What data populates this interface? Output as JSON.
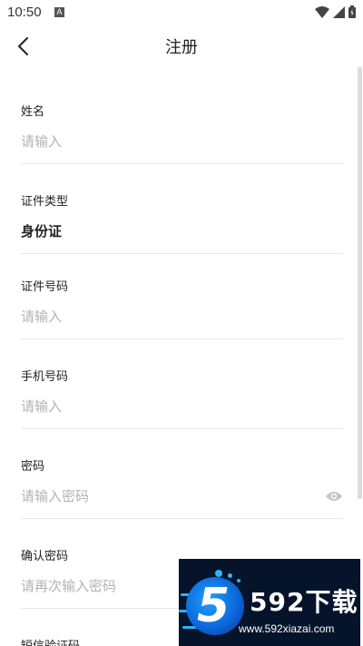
{
  "status_bar": {
    "time": "10:50",
    "notification_icon": "A",
    "icons": [
      "wifi-icon",
      "signal-icon",
      "battery-icon"
    ]
  },
  "header": {
    "title": "注册",
    "back_icon": "chevron-left-icon"
  },
  "form": {
    "name": {
      "label": "姓名",
      "placeholder": "请输入"
    },
    "id_type": {
      "label": "证件类型",
      "value": "身份证"
    },
    "id_number": {
      "label": "证件号码",
      "placeholder": "请输入"
    },
    "phone": {
      "label": "手机号码",
      "placeholder": "请输入"
    },
    "password": {
      "label": "密码",
      "placeholder": "请输入密码",
      "toggle_icon": "eye-icon"
    },
    "confirm_password": {
      "label": "确认密码",
      "placeholder": "请再次输入密码"
    },
    "sms_code": {
      "label": "短信验证码"
    }
  },
  "watermark": {
    "logo_digit": "5",
    "brand": "592下载",
    "url": "www.592xiazai.com"
  },
  "colors": {
    "placeholder": "#b3b3b3",
    "divider": "#e8e8e8",
    "watermark_bg": "#05142b",
    "watermark_accent": "#2db2ff"
  }
}
